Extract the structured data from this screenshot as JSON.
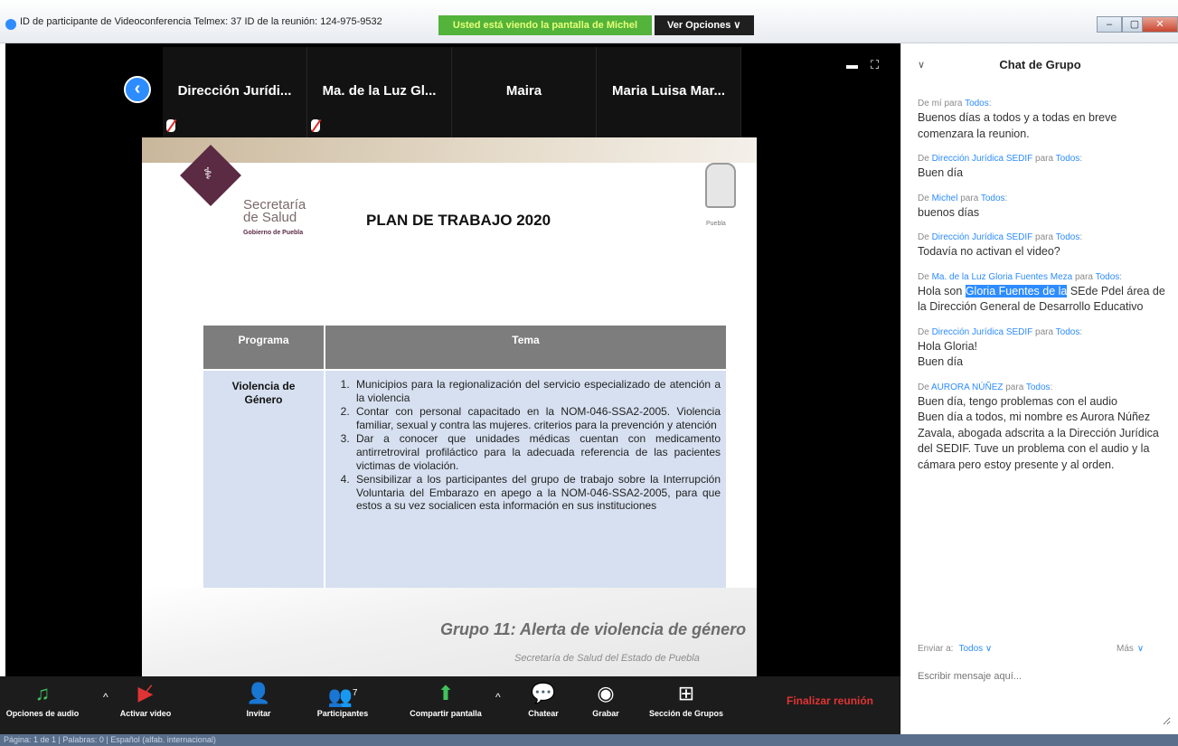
{
  "window": {
    "title": "ID de participante de Videoconferencia Telmex: 37  ID de la reunión: 124-975-9532",
    "banner": "Usted está viendo la pantalla de Michel",
    "view_options": "Ver Opciones ∨",
    "controls": [
      "–",
      "▢",
      "✕"
    ]
  },
  "participants": [
    {
      "name": "Dirección Jurídi...",
      "muted": true
    },
    {
      "name": "Ma. de la Luz Gl...",
      "muted": true
    },
    {
      "name": "Maira",
      "muted": false
    },
    {
      "name": "Maria Luisa Mar...",
      "muted": false
    }
  ],
  "slide": {
    "org_line1": "Secretaría",
    "org_line2": "de Salud",
    "org_line3": "Gobierno de Puebla",
    "title": "PLAN DE TRABAJO 2020",
    "seal_label": "Puebla",
    "table": {
      "headers": [
        "Programa",
        "Tema"
      ],
      "programa": "Violencia de\nGénero",
      "items": [
        "Municipios para la regionalización del servicio especializado de atención a la violencia",
        "Contar con personal capacitado en la NOM-046-SSA2-2005. Violencia familiar, sexual y contra las mujeres. criterios para la prevención y atención",
        "Dar a conocer que unidades médicas cuentan con medicamento antirretroviral profiláctico para la adecuada referencia de las pacientes victimas de violación.",
        "Sensibilizar a los participantes del grupo de trabajo sobre la Interrupción Voluntaria del Embarazo en apego a la NOM-046-SSA2-2005, para que estos a su vez socialicen esta información en sus instituciones"
      ]
    },
    "group_title": "Grupo 11: Alerta de violencia de género",
    "group_subtitle": "Secretaría de Salud del Estado de Puebla"
  },
  "toolbar": {
    "audio": "Opciones de audio",
    "video": "Activar video",
    "invite": "Invitar",
    "participants": "Participantes",
    "participants_count": "7",
    "share": "Compartir pantalla",
    "chat": "Chatear",
    "record": "Grabar",
    "breakout": "Sección de Grupos",
    "end": "Finalizar reunión"
  },
  "statusbar": "Página: 1 de 1  |  Palabras: 0  |  Español (alfab. internacional)",
  "chat": {
    "title": "Chat de Grupo",
    "messages": [
      {
        "from": "mí",
        "to": "Todos",
        "text": "Buenos días a todos y a todas en breve comenzara la reunion."
      },
      {
        "from": "Dirección Jurídica SEDIF",
        "to": "Todos",
        "text": "Buen día"
      },
      {
        "from": "Michel",
        "to": "Todos",
        "text": "buenos días"
      },
      {
        "from": "Dirección Jurídica SEDIF",
        "to": "Todos",
        "text": "Todavía no activan el video?"
      },
      {
        "from": "Ma. de la Luz Gloria Fuentes Meza",
        "to": "Todos",
        "text_before": "Hola son ",
        "text_highlight": "Gloria Fuentes de la",
        "text_after": " SEde Pdel área de la Dirección General de Desarrollo Educativo"
      },
      {
        "from": "Dirección Jurídica SEDIF",
        "to": "Todos",
        "text": "Hola Gloria!\nBuen día"
      },
      {
        "from": "AURORA NÚÑEZ",
        "to": "Todos",
        "text": "Buen día, tengo problemas con el audio\nBuen día a todos, mi nombre es Aurora Núñez Zavala, abogada adscrita a la Dirección Jurídica del SEDIF. Tuve un problema con el audio y la cámara pero estoy presente y al orden."
      }
    ],
    "send_to_label": "Enviar a:",
    "send_to_value": "Todos ∨",
    "more": "Más",
    "placeholder": "Escribir mensaje aquí..."
  }
}
